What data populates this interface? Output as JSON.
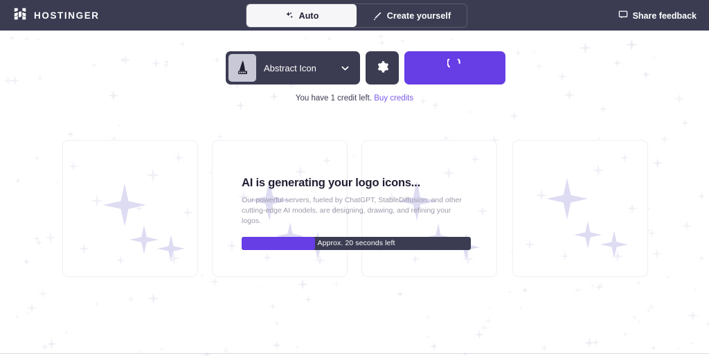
{
  "header": {
    "brand": "HOSTINGER",
    "brand_icon": "hostinger-h-logo-icon",
    "tabs": [
      {
        "label": "Auto",
        "icon": "sparkle-icon",
        "active": true
      },
      {
        "label": "Create yourself",
        "icon": "magic-wand-icon",
        "active": false
      }
    ],
    "share_feedback": {
      "label": "Share feedback",
      "icon": "chat-bubble-icon"
    },
    "bg_color": "#3b3b52"
  },
  "control_bar": {
    "style_select": {
      "value": "Abstract Icon",
      "thumbnail_icon": "wizard-hat-logo-icon",
      "chevron_icon": "chevron-down-icon"
    },
    "settings_button": {
      "icon": "gear-icon",
      "label": ""
    },
    "generate_button": {
      "icon": "loading-spinner-icon",
      "label": "",
      "color": "#673de6",
      "state": "loading"
    }
  },
  "credits": {
    "text": "You have 1 credit left.",
    "link_label": "Buy credits",
    "link_color": "#7b59e8",
    "amount": 1
  },
  "results": {
    "cards": [
      {
        "state": "empty-placeholder"
      },
      {
        "state": "empty-placeholder"
      },
      {
        "state": "empty-placeholder"
      },
      {
        "state": "empty-placeholder"
      }
    ]
  },
  "generating": {
    "title": "AI is generating your logo icons...",
    "description": "Our powerful servers, fueled by ChatGPT, StableDiffusion, and other cutting-edge AI models, are designing, drawing, and refining your logos.",
    "progress": {
      "label": "Approx. 20 seconds left",
      "percent": 32,
      "fill_color": "#673de6",
      "track_color": "#3b3b52"
    }
  }
}
